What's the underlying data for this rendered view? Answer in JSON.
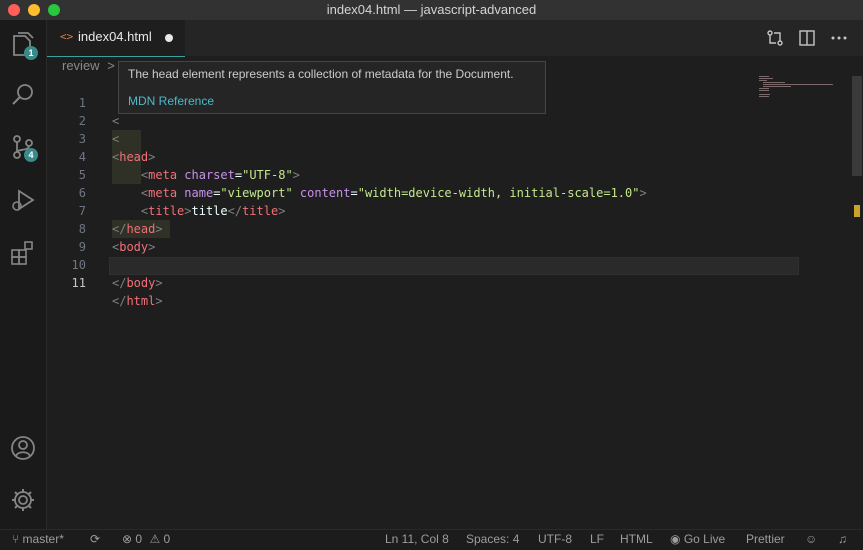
{
  "window": {
    "title": "index04.html — javascript-advanced"
  },
  "activity_bar": {
    "explorer_badge": "1",
    "source_control_badge": "4"
  },
  "tab": {
    "label": "index04.html",
    "icon": "code-brackets-icon"
  },
  "breadcrumb": {
    "folder": "review",
    "separator": ">"
  },
  "hover": {
    "text": "The head element represents a collection of metadata for the Document.",
    "link": "MDN Reference"
  },
  "editor": {
    "line_numbers": [
      "1",
      "2",
      "3",
      "4",
      "5",
      "6",
      "7",
      "8",
      "9",
      "10",
      "11"
    ],
    "active_line": "11",
    "line1_start": "<",
    "line2_start": "<",
    "head_open_lt": "<",
    "head_open_name": "head",
    "head_open_gt": ">",
    "meta1_lt": "<",
    "meta1_name": "meta",
    "meta1_attr": "charset",
    "meta1_eq": "=",
    "meta1_val": "\"UTF-8\"",
    "meta1_gt": ">",
    "meta2_lt": "<",
    "meta2_name": "meta",
    "meta2_attr1": "name",
    "meta2_eq1": "=",
    "meta2_val1": "\"viewport\"",
    "meta2_attr2": "content",
    "meta2_eq2": "=",
    "meta2_val2": "\"width=device-width, initial-scale=1.0\"",
    "meta2_gt": ">",
    "title_lt": "<",
    "title_name": "title",
    "title_gt": ">",
    "title_text": "title",
    "title_close_lt": "</",
    "title_close_name": "title",
    "title_close_gt": ">",
    "head_close_lt": "</",
    "head_close_name": "head",
    "head_close_gt": ">",
    "body_open_lt": "<",
    "body_open_name": "body",
    "body_open_gt": ">",
    "body_close_lt": "</",
    "body_close_name": "body",
    "body_close_gt": ">",
    "html_close_lt": "</",
    "html_close_name": "html",
    "html_close_gt": ">"
  },
  "status_bar": {
    "branch": "master*",
    "errors": "0",
    "warnings": "0",
    "position": "Ln 11, Col 8",
    "spaces": "Spaces: 4",
    "encoding": "UTF-8",
    "eol": "LF",
    "language": "HTML",
    "go_live": "Go Live",
    "formatter": "Prettier"
  },
  "colors": {
    "accent": "#3aa0a0",
    "tag": "#f07178",
    "attribute": "#c792ea",
    "string": "#c3e88d",
    "link": "#4fb8c8"
  }
}
